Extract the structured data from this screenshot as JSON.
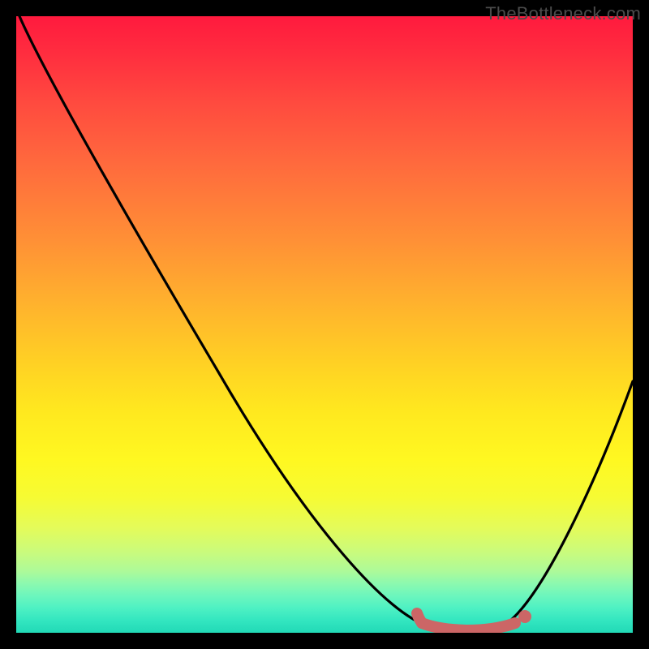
{
  "watermark": {
    "text": "TheBottleneck.com"
  },
  "chart_data": {
    "type": "line",
    "title": "",
    "xlabel": "",
    "ylabel": "",
    "xlim": [
      0,
      100
    ],
    "ylim": [
      0,
      100
    ],
    "background": {
      "type": "vertical-gradient",
      "stops": [
        {
          "pos": 0,
          "color": "#ff1a3e"
        },
        {
          "pos": 50,
          "color": "#ffd024"
        },
        {
          "pos": 80,
          "color": "#f6fb33"
        },
        {
          "pos": 100,
          "color": "#21d9b6"
        }
      ],
      "note": "color encodes bottleneck severity; green (bottom) = no bottleneck, red (top) = severe"
    },
    "series": [
      {
        "name": "bottleneck-curve",
        "note": "V-shaped curve; y is bottleneck severity (0 at minimum). x is relative hardware performance. Values estimated from pixels.",
        "x": [
          0,
          10,
          20,
          30,
          40,
          50,
          60,
          68,
          72,
          78,
          82,
          90,
          100
        ],
        "y": [
          100,
          85,
          70,
          55,
          40,
          25,
          10,
          2,
          0,
          0,
          2,
          18,
          40
        ]
      }
    ],
    "marker": {
      "name": "recommended-range",
      "note": "thick salmon segment along curve floor and dot at right end, values estimated",
      "x_range": [
        66,
        82
      ],
      "y": 0,
      "dot_x": 82,
      "dot_y": 2,
      "color": "#cc6666"
    }
  }
}
